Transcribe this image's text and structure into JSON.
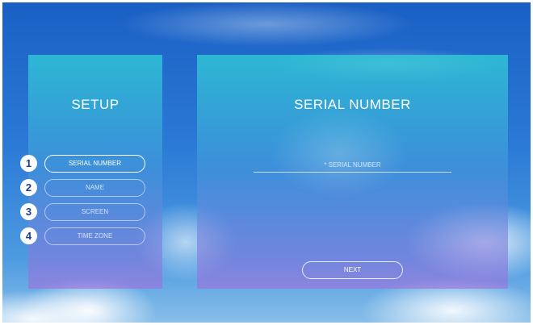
{
  "setup": {
    "title": "SETUP",
    "steps": [
      {
        "number": "1",
        "label": "SERIAL NUMBER",
        "active": true
      },
      {
        "number": "2",
        "label": "NAME",
        "active": false
      },
      {
        "number": "3",
        "label": "SCREEN",
        "active": false
      },
      {
        "number": "4",
        "label": "TIME ZONE",
        "active": false
      }
    ]
  },
  "form": {
    "title": "SERIAL NUMBER",
    "serial_placeholder": "* SERIAL NUMBER",
    "serial_value": "",
    "next_label": "NEXT"
  },
  "colors": {
    "panel_top": "#30ced6",
    "panel_bottom": "#a06edc",
    "step_number_text": "#1d3f86"
  }
}
